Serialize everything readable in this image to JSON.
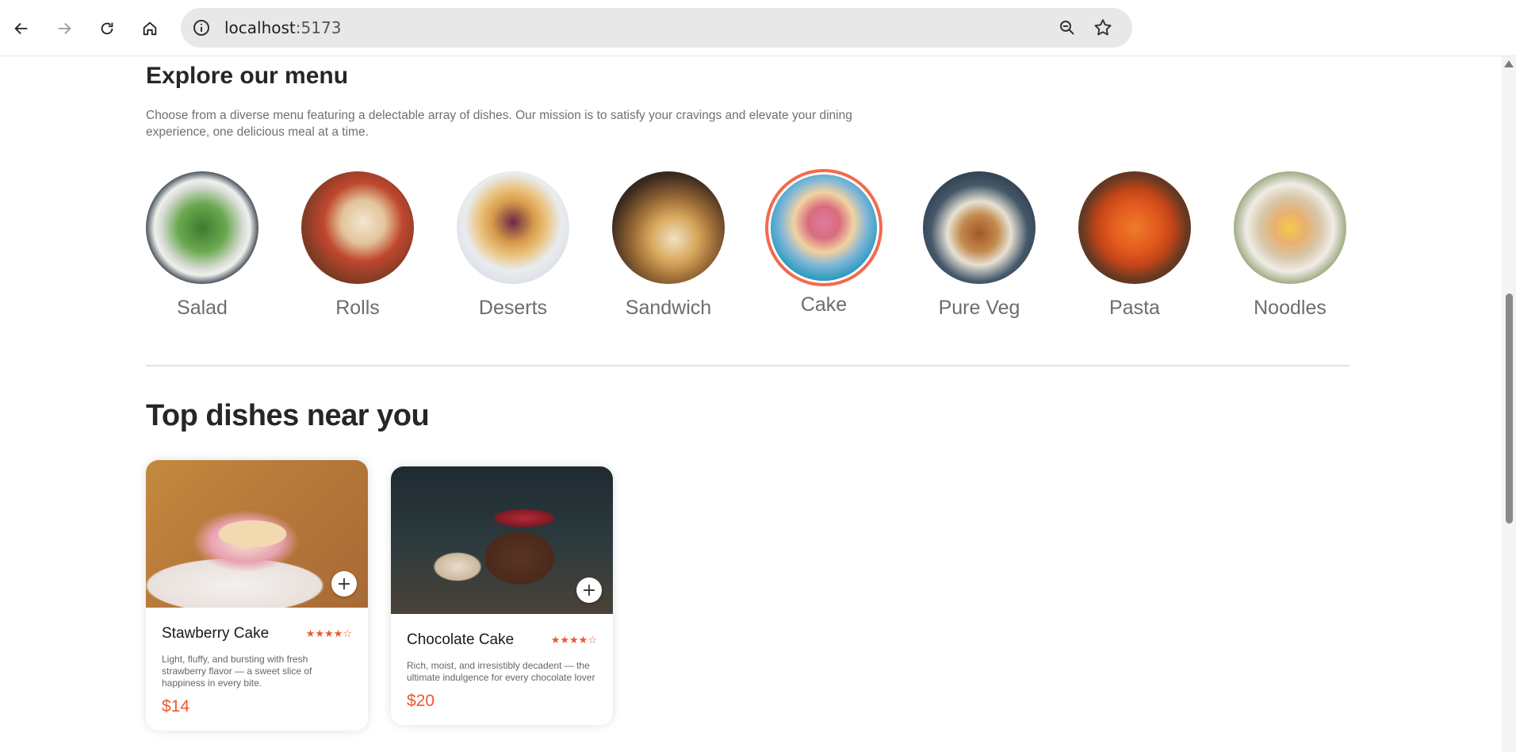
{
  "browser": {
    "url_host": "localhost",
    "url_port": ":5173"
  },
  "menu": {
    "title": "Explore our menu",
    "description": "Choose from a diverse menu featuring a delectable array of dishes. Our mission is to satisfy your cravings and elevate your dining experience, one delicious meal at a time.",
    "categories": [
      {
        "label": "Salad"
      },
      {
        "label": "Rolls"
      },
      {
        "label": "Deserts"
      },
      {
        "label": "Sandwich"
      },
      {
        "label": "Cake",
        "active": true
      },
      {
        "label": "Pure Veg"
      },
      {
        "label": "Pasta"
      },
      {
        "label": "Noodles"
      }
    ]
  },
  "top_dishes": {
    "title": "Top dishes near you",
    "items": [
      {
        "name": "Stawberry Cake",
        "rating": 4,
        "stars": "★★★★☆",
        "description": "Light, fluffy, and bursting with fresh strawberry flavor — a sweet slice of happiness in every bite.",
        "price": "$14",
        "add_label": "+"
      },
      {
        "name": "Chocolate Cake",
        "rating": 4,
        "stars": "★★★★☆",
        "description": "Rich, moist, and irresistibly decadent — the ultimate indulgence for every chocolate lover",
        "price": "$20",
        "add_label": "+"
      }
    ]
  },
  "colors": {
    "accent": "#f26a4e",
    "price": "#f0562f"
  }
}
